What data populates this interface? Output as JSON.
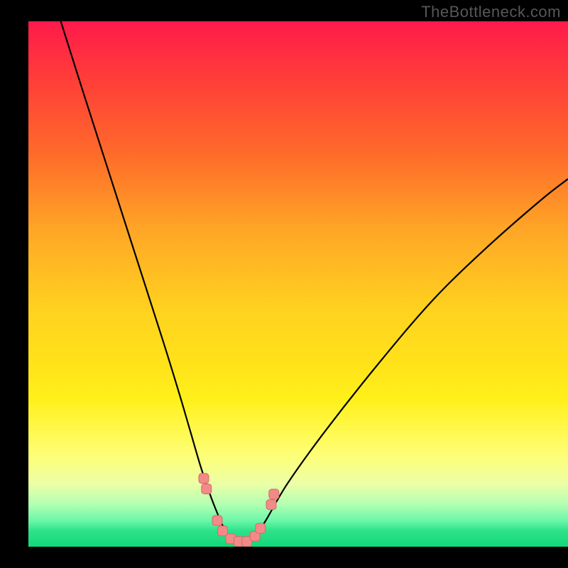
{
  "watermark": "TheBottleneck.com",
  "colors": {
    "frame_bg": "#000000",
    "curve": "#000000",
    "marker_fill": "#f28a88",
    "marker_stroke": "#d46a66",
    "gradient_top": "#ff1a4b",
    "gradient_bottom": "#13d879"
  },
  "chart_data": {
    "type": "line",
    "title": "",
    "xlabel": "",
    "ylabel": "",
    "xlim": [
      0,
      100
    ],
    "ylim": [
      0,
      100
    ],
    "grid": false,
    "legend": null,
    "series": [
      {
        "name": "bottleneck-curve",
        "x": [
          6,
          10,
          15,
          20,
          25,
          28,
          30,
          32,
          34,
          36,
          37,
          38,
          39,
          40,
          41,
          42,
          44,
          48,
          55,
          65,
          75,
          85,
          95,
          100
        ],
        "y": [
          100,
          87,
          71,
          55,
          39,
          29,
          22,
          15,
          9,
          4,
          2,
          1,
          0.5,
          0.5,
          1,
          2,
          5,
          12,
          22,
          35,
          47,
          57,
          66,
          70
        ]
      }
    ],
    "markers": [
      {
        "x": 32.5,
        "y": 13
      },
      {
        "x": 33.0,
        "y": 11
      },
      {
        "x": 35.0,
        "y": 5
      },
      {
        "x": 36.0,
        "y": 3
      },
      {
        "x": 37.5,
        "y": 1.5
      },
      {
        "x": 39.0,
        "y": 1
      },
      {
        "x": 40.5,
        "y": 1
      },
      {
        "x": 42.0,
        "y": 2
      },
      {
        "x": 43.0,
        "y": 3.5
      },
      {
        "x": 45.0,
        "y": 8
      },
      {
        "x": 45.5,
        "y": 10
      }
    ]
  }
}
